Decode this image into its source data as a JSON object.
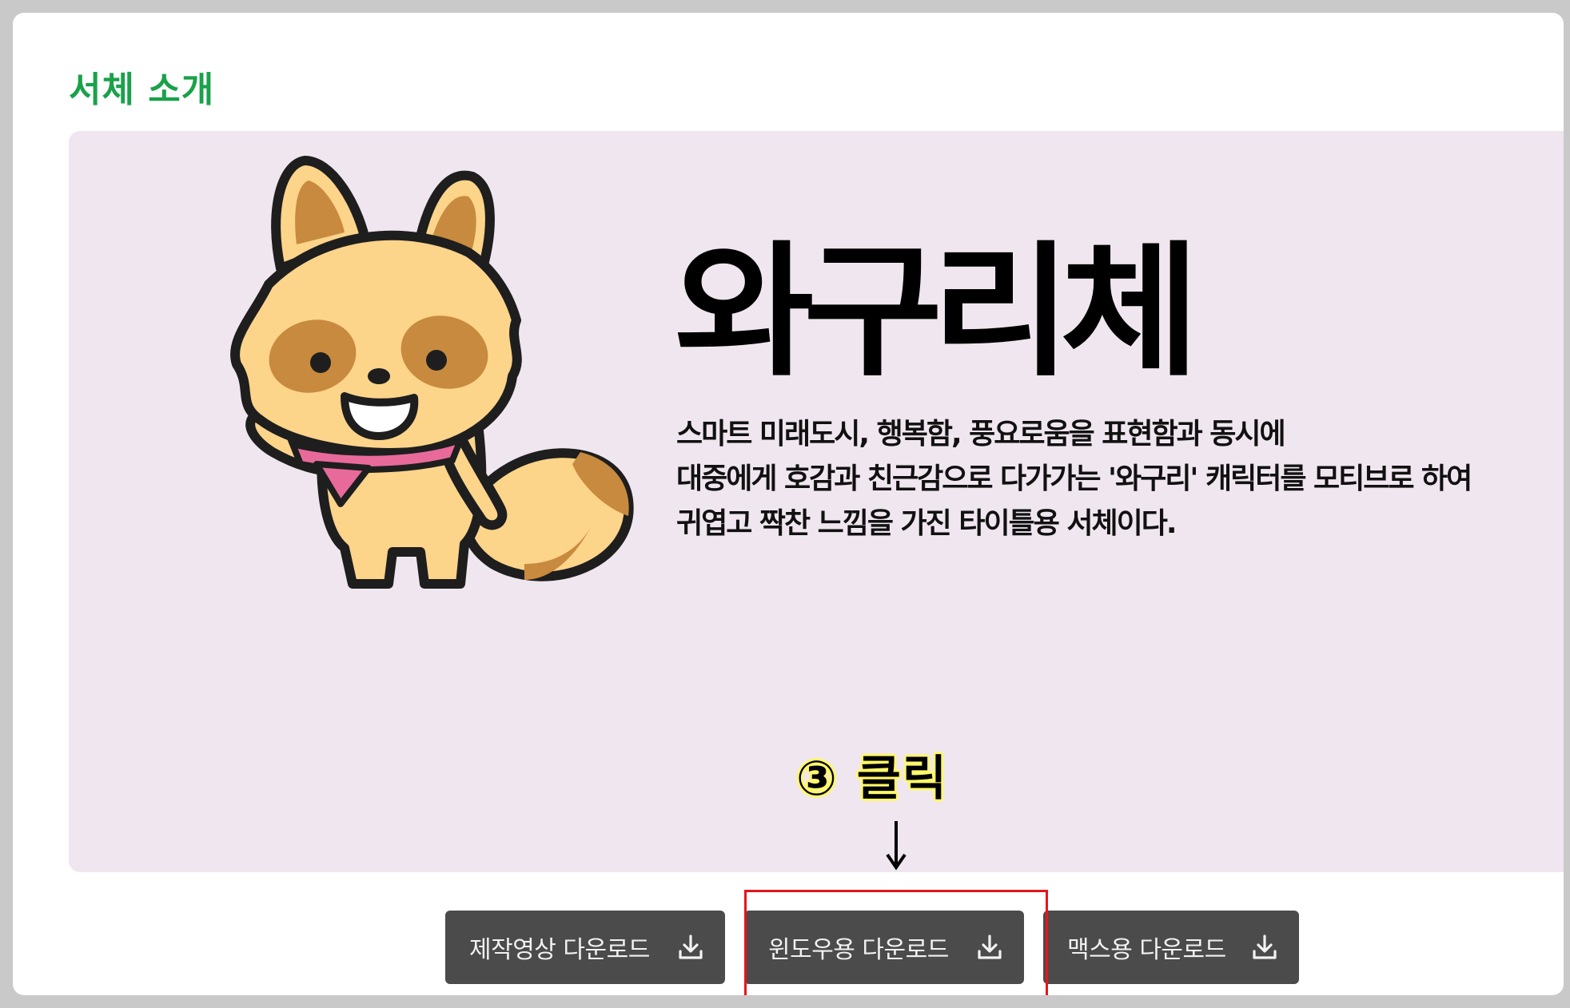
{
  "section": {
    "title": "서체 소개"
  },
  "font": {
    "name": "와구리체",
    "description_lines": [
      "스마트 미래도시, 행복함, 풍요로움을 표현함과 동시에",
      "대중에게 호감과 친근감으로 다가가는 '와구리' 캐릭터를 모티브로 하여",
      "귀엽고 짝찬 느낌을 가진 타이틀용 서체이다."
    ]
  },
  "annotation": {
    "label": "③ 클릭",
    "highlight_color": "#e8141b",
    "label_bg": "#fff86a"
  },
  "buttons": [
    {
      "label": "제작영상 다운로드",
      "icon": "download-icon"
    },
    {
      "label": "윈도우용 다운로드",
      "icon": "download-icon"
    },
    {
      "label": "맥스용 다운로드",
      "icon": "download-icon"
    }
  ],
  "colors": {
    "accent_green": "#1aa14a",
    "banner_bg": "#f0e6ef",
    "button_bg": "#4b4b4b",
    "mascot_fur": "#fcd48a",
    "mascot_patch": "#c88a3e",
    "scarf": "#e86a9a"
  }
}
